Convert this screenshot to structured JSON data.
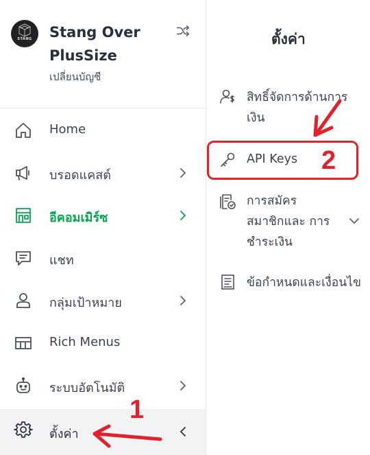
{
  "account": {
    "name": "Stang Over PlusSize",
    "switch_label": "เปลี่ยนบัญชี",
    "avatar_logo_text": "STANG"
  },
  "nav": {
    "items": [
      {
        "label": "Home",
        "icon": "home-icon"
      },
      {
        "label": "บรอดแคสต์",
        "icon": "megaphone-icon"
      },
      {
        "label": "อีคอมเมิร์ซ",
        "icon": "store-icon"
      },
      {
        "label": "แชท",
        "icon": "chat-icon"
      },
      {
        "label": "กลุ่มเป้าหมาย",
        "icon": "user-icon"
      },
      {
        "label": "Rich Menus",
        "icon": "layout-icon"
      },
      {
        "label": "ระบบอัตโนมัติ",
        "icon": "bot-icon"
      },
      {
        "label": "ตั้งค่า",
        "icon": "gear-icon"
      }
    ]
  },
  "panel": {
    "title": "ตั้งค่า",
    "items": [
      {
        "label_line1": "สิทธิ์จัดการด้านการ",
        "label_line2": "เงิน",
        "icon": "money-permission-icon"
      },
      {
        "label": "API Keys",
        "icon": "key-icon"
      },
      {
        "label_line1": "การสมัคร",
        "label_line2": "สมาชิกและ การ",
        "label_line3": "ชำระเงิน",
        "icon": "subscription-icon"
      },
      {
        "label": "ข้อกำหนดและเงื่อนไข",
        "icon": "terms-icon"
      }
    ]
  },
  "annotations": {
    "step1": "1",
    "step2": "2",
    "color": "#e3212a"
  },
  "colors": {
    "active_green": "#06a64f",
    "text": "#3b4350",
    "border": "#e3e6ea"
  }
}
